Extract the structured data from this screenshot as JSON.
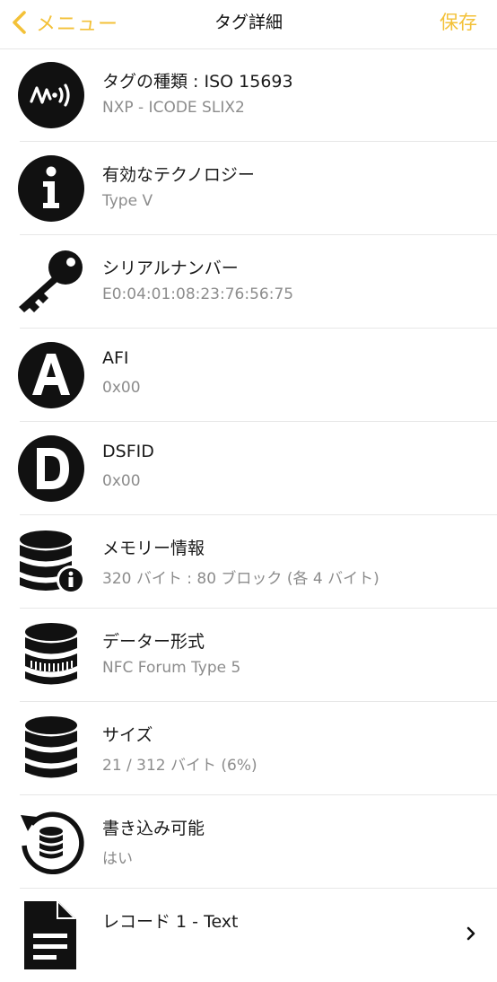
{
  "navbar": {
    "back_label": "メニュー",
    "title": "タグ詳細",
    "save_label": "保存",
    "accent_color": "#f3c138"
  },
  "rows": [
    {
      "icon": "nfc-icon",
      "title": "タグの種類 : ISO 15693",
      "subtitle": "NXP - ICODE SLIX2"
    },
    {
      "icon": "info-icon",
      "title": "有効なテクノロジー",
      "subtitle": "Type V"
    },
    {
      "icon": "key-icon",
      "title": "シリアルナンバー",
      "subtitle": "E0:04:01:08:23:76:56:75"
    },
    {
      "icon": "letter-a-icon",
      "title": "AFI",
      "subtitle": "0x00"
    },
    {
      "icon": "letter-d-icon",
      "title": "DSFID",
      "subtitle": "0x00"
    },
    {
      "icon": "database-info-icon",
      "title": "メモリー情報",
      "subtitle": "320 バイト : 80 ブロック (各 4 バイト)"
    },
    {
      "icon": "database-format-icon",
      "title": "データー形式",
      "subtitle": "NFC Forum Type 5"
    },
    {
      "icon": "database-icon",
      "title": "サイズ",
      "subtitle": "21 / 312 バイト (6%)"
    },
    {
      "icon": "database-writable-icon",
      "title": "書き込み可能",
      "subtitle": "はい"
    },
    {
      "icon": "document-icon",
      "title": "レコード 1 - Text",
      "subtitle": ""
    }
  ]
}
